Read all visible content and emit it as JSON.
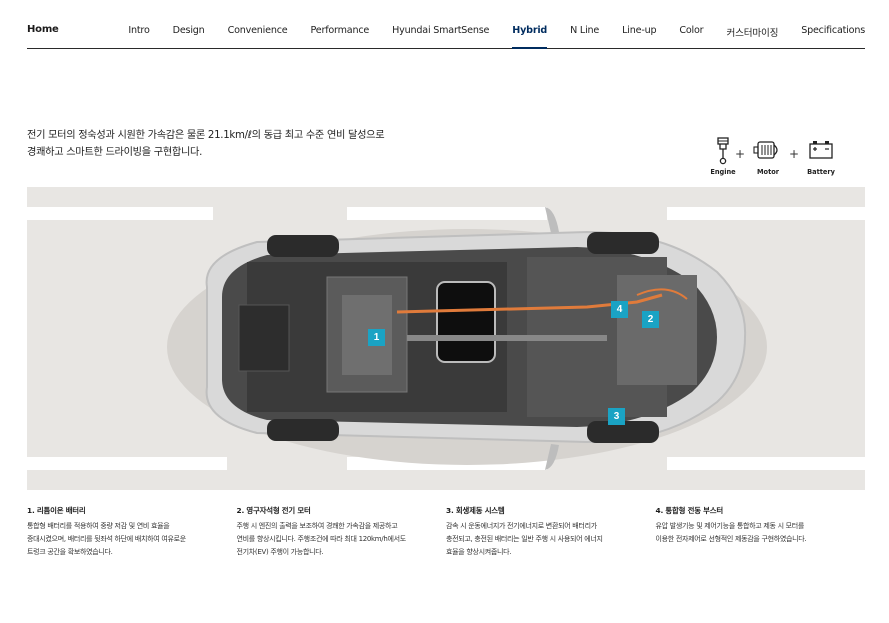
{
  "nav": {
    "home": "Home",
    "items": [
      "Intro",
      "Design",
      "Convenience",
      "Performance",
      "Hyundai SmartSense",
      "Hybrid",
      "N Line",
      "Line-up",
      "Color",
      "커스터마이징",
      "Specifications"
    ],
    "active_index": 5
  },
  "intro": {
    "line1": "전기 모터의 정숙성과 시원한 가속감은 물론 21.1km/ℓ의 동급 최고 수준 연비 달성으로",
    "line2": "경쾌하고 스마트한 드라이빙을 구현합니다."
  },
  "components": {
    "engine": "Engine",
    "motor": "Motor",
    "battery": "Battery",
    "plus": "+"
  },
  "markers": [
    "1",
    "2",
    "3",
    "4"
  ],
  "features": [
    {
      "title": "1. 리튬이온 배터리",
      "lines": [
        "통합형 배터리를 적용하여 중량 저감 및 연비 효율을",
        "증대시켰으며, 배터리를 뒷좌석 하단에 배치하여 여유로운",
        "트렁크 공간을 확보하였습니다."
      ]
    },
    {
      "title": "2. 영구자석형 전기 모터",
      "lines": [
        "주행 시 엔진의 출력을 보조하여 경쾌한 가속감을 제공하고",
        "연비를 향상시킵니다. 주행조건에 따라 최대 120km/h에서도",
        "전기차(EV) 주행이 가능합니다."
      ]
    },
    {
      "title": "3. 회생제동 시스템",
      "lines": [
        "감속 시 운동에너지가 전기에너지로 변환되어 배터리가",
        "충전되고, 충전된 배터리는 일반 주행 시 사용되어 에너지",
        "효율을 향상시켜줍니다."
      ]
    },
    {
      "title": "4. 통합형 전동 부스터",
      "lines": [
        "유압 발생기능 및 제어기능을 통합하고 제동 시 모터를",
        "이용한 전자제어로 선형적인 제동감을 구현하였습니다."
      ]
    }
  ],
  "colors": {
    "accent": "#002c5f",
    "marker": "#1aa3c4",
    "stage_bg": "#e8e6e3"
  }
}
